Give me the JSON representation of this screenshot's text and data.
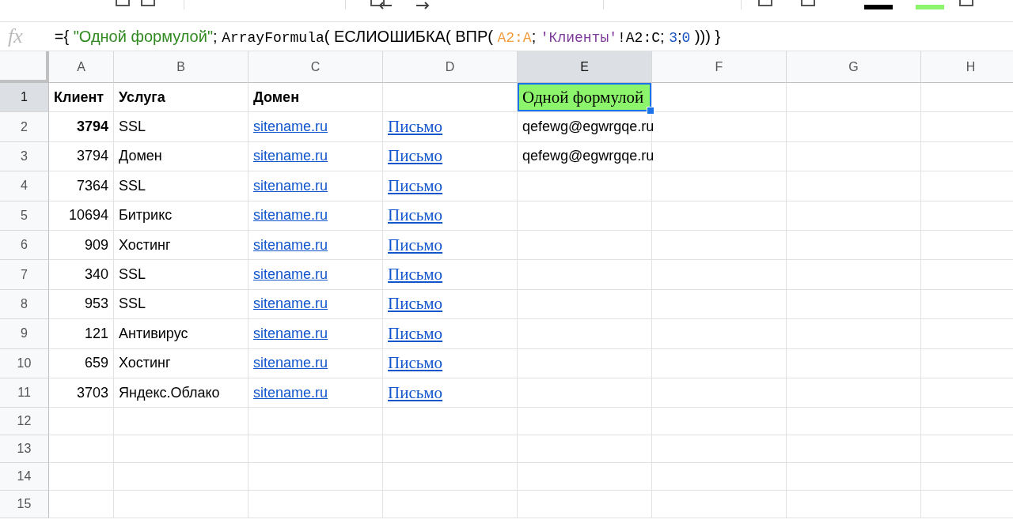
{
  "formula_bar": {
    "function_label": "fx",
    "tokens": [
      {
        "kind": "plain",
        "text": "={ "
      },
      {
        "kind": "string",
        "text": "\"Одной формулой\""
      },
      {
        "kind": "plain",
        "text": "; "
      },
      {
        "kind": "mono",
        "text": "ArrayFormula"
      },
      {
        "kind": "plain",
        "text": "( ЕСЛИОШИБКА( ВПР( "
      },
      {
        "kind": "range1",
        "text": "A2:A"
      },
      {
        "kind": "plain",
        "text": "; "
      },
      {
        "kind": "range2",
        "text": "'Клиенты'"
      },
      {
        "kind": "mono",
        "text": "!A2:C"
      },
      {
        "kind": "plain",
        "text": "; "
      },
      {
        "kind": "number",
        "text": "3"
      },
      {
        "kind": "plain",
        "text": ";"
      },
      {
        "kind": "number",
        "text": "0"
      },
      {
        "kind": "plain",
        "text": " ))) }"
      }
    ]
  },
  "columns": [
    {
      "label": "A",
      "selected": false
    },
    {
      "label": "B",
      "selected": false
    },
    {
      "label": "C",
      "selected": false
    },
    {
      "label": "D",
      "selected": false
    },
    {
      "label": "E",
      "selected": true
    },
    {
      "label": "F",
      "selected": false
    },
    {
      "label": "G",
      "selected": false
    },
    {
      "label": "H",
      "selected": false
    }
  ],
  "rows": [
    {
      "number": "1",
      "selected": true,
      "cells": [
        {
          "kind": "text",
          "text": "Клиент",
          "bold": true
        },
        {
          "kind": "text",
          "text": "Услуга",
          "bold": true
        },
        {
          "kind": "text",
          "text": "Домен",
          "bold": true
        },
        null,
        {
          "kind": "highlight",
          "text": "Одной формулой",
          "selected": true
        }
      ]
    },
    {
      "number": "2",
      "selected": false,
      "cells": [
        {
          "kind": "number",
          "text": "3794",
          "bold": true
        },
        {
          "kind": "text",
          "text": "SSL",
          "bold": false
        },
        {
          "kind": "link",
          "text": "sitename.ru"
        },
        {
          "kind": "serif-link",
          "text": "Письмо"
        },
        {
          "kind": "text",
          "text": "qefewg@egwrgqe.ru",
          "bold": false
        }
      ]
    },
    {
      "number": "3",
      "selected": false,
      "cells": [
        {
          "kind": "number",
          "text": "3794",
          "bold": false
        },
        {
          "kind": "text",
          "text": "Домен",
          "bold": false
        },
        {
          "kind": "link",
          "text": "sitename.ru"
        },
        {
          "kind": "serif-link",
          "text": "Письмо"
        },
        {
          "kind": "text",
          "text": "qefewg@egwrgqe.ru",
          "bold": false
        }
      ]
    },
    {
      "number": "4",
      "selected": false,
      "cells": [
        {
          "kind": "number",
          "text": "7364",
          "bold": false
        },
        {
          "kind": "text",
          "text": "SSL",
          "bold": false
        },
        {
          "kind": "link",
          "text": "sitename.ru"
        },
        {
          "kind": "serif-link",
          "text": "Письмо"
        }
      ]
    },
    {
      "number": "5",
      "selected": false,
      "cells": [
        {
          "kind": "number",
          "text": "10694",
          "bold": false
        },
        {
          "kind": "text",
          "text": "Битрикс",
          "bold": false
        },
        {
          "kind": "link",
          "text": "sitename.ru"
        },
        {
          "kind": "serif-link",
          "text": "Письмо"
        }
      ]
    },
    {
      "number": "6",
      "selected": false,
      "cells": [
        {
          "kind": "number",
          "text": "909",
          "bold": false
        },
        {
          "kind": "text",
          "text": "Хостинг",
          "bold": false
        },
        {
          "kind": "link",
          "text": "sitename.ru"
        },
        {
          "kind": "serif-link",
          "text": "Письмо"
        }
      ]
    },
    {
      "number": "7",
      "selected": false,
      "cells": [
        {
          "kind": "number",
          "text": "340",
          "bold": false
        },
        {
          "kind": "text",
          "text": "SSL",
          "bold": false
        },
        {
          "kind": "link",
          "text": "sitename.ru"
        },
        {
          "kind": "serif-link",
          "text": "Письмо"
        }
      ]
    },
    {
      "number": "8",
      "selected": false,
      "cells": [
        {
          "kind": "number",
          "text": "953",
          "bold": false
        },
        {
          "kind": "text",
          "text": "SSL",
          "bold": false
        },
        {
          "kind": "link",
          "text": "sitename.ru"
        },
        {
          "kind": "serif-link",
          "text": "Письмо"
        }
      ]
    },
    {
      "number": "9",
      "selected": false,
      "cells": [
        {
          "kind": "number",
          "text": "121",
          "bold": false
        },
        {
          "kind": "text",
          "text": "Антивирус",
          "bold": false
        },
        {
          "kind": "link",
          "text": "sitename.ru"
        },
        {
          "kind": "serif-link",
          "text": "Письмо"
        }
      ]
    },
    {
      "number": "10",
      "selected": false,
      "cells": [
        {
          "kind": "number",
          "text": "659",
          "bold": false
        },
        {
          "kind": "text",
          "text": "Хостинг",
          "bold": false
        },
        {
          "kind": "link",
          "text": "sitename.ru"
        },
        {
          "kind": "serif-link",
          "text": "Письмо"
        }
      ]
    },
    {
      "number": "11",
      "selected": false,
      "cells": [
        {
          "kind": "number",
          "text": "3703",
          "bold": false
        },
        {
          "kind": "text",
          "text": "Яндекс.Облако",
          "bold": false
        },
        {
          "kind": "link",
          "text": "sitename.ru"
        },
        {
          "kind": "serif-link",
          "text": "Письмо"
        }
      ]
    },
    {
      "number": "12",
      "selected": false,
      "cells": []
    },
    {
      "number": "13",
      "selected": false,
      "cells": []
    },
    {
      "number": "14",
      "selected": false,
      "cells": []
    },
    {
      "number": "15",
      "selected": false,
      "cells": []
    }
  ]
}
